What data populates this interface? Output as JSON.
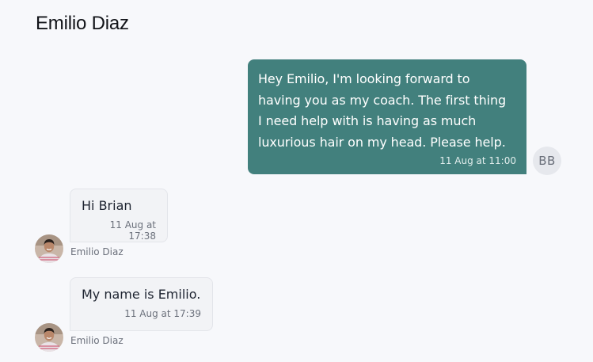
{
  "header": {
    "title": "Emilio Diaz"
  },
  "messages": [
    {
      "direction": "outgoing",
      "text": "Hey Emilio, I'm looking forward to\nhaving you as my coach. The first thing\nI need help with is having as much\nluxurious hair on my head. Please help.",
      "time": "11 Aug at 11:00",
      "avatar_initials": "BB"
    },
    {
      "direction": "incoming",
      "text": "Hi Brian",
      "time": "11 Aug at 17:38",
      "sender": "Emilio Diaz"
    },
    {
      "direction": "incoming",
      "text": "My name is Emilio.",
      "time": "11 Aug at 17:39",
      "sender": "Emilio Diaz"
    }
  ],
  "colors": {
    "outgoing_bubble": "#42807d",
    "incoming_bubble": "#f2f3f6",
    "background": "#f7f8fb"
  }
}
